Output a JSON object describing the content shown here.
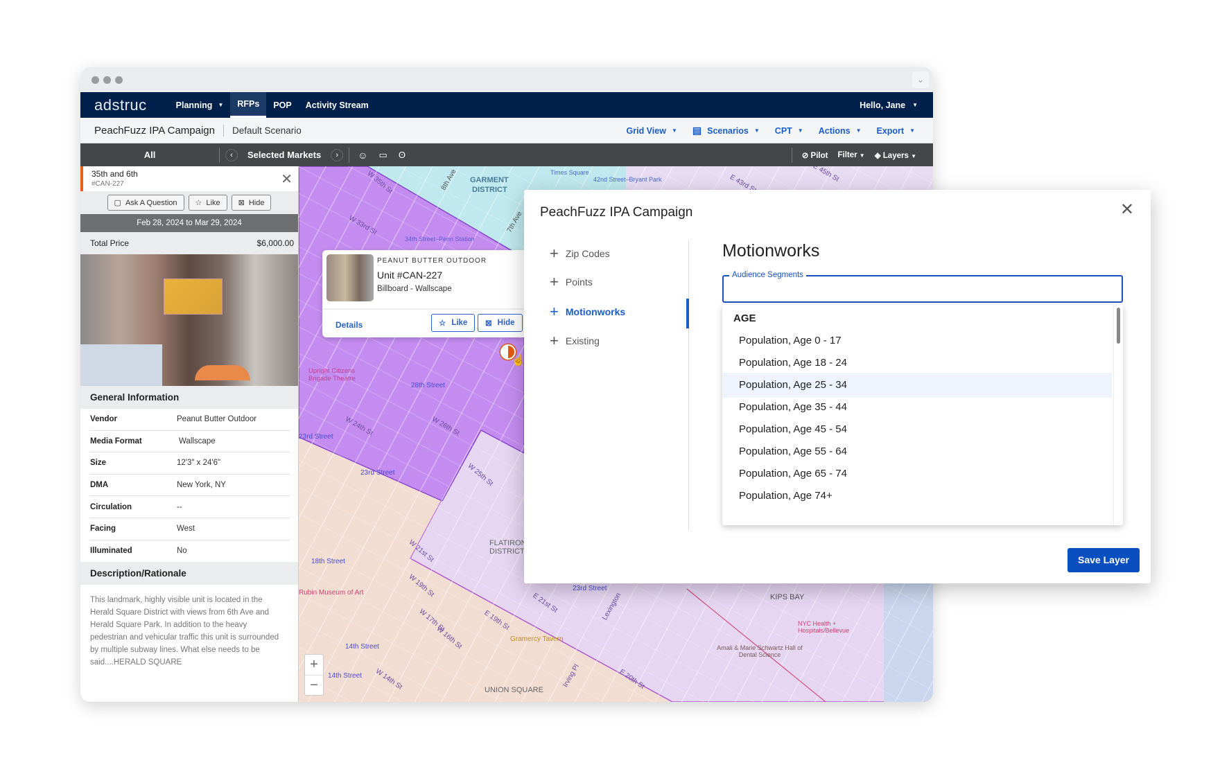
{
  "app": {
    "logo": "adstruc",
    "nav": [
      {
        "label": "Planning"
      },
      {
        "label": "RFPs"
      },
      {
        "label": "POP"
      },
      {
        "label": "Activity Stream"
      }
    ],
    "user": "Hello, Jane"
  },
  "subheader": {
    "campaign": "PeachFuzz IPA Campaign",
    "scenario": "Default Scenario",
    "menus": [
      "Grid View",
      "Scenarios",
      "CPT",
      "Actions",
      "Export"
    ]
  },
  "toolbar": {
    "all": "All",
    "markets": "Selected Markets",
    "pilot": "Pilot",
    "filter": "Filter",
    "layers": "Layers"
  },
  "unit_panel": {
    "title": "35th and 6th",
    "id": "#CAN-227",
    "buttons": [
      "Ask A Question",
      "Like",
      "Hide"
    ],
    "dates": "Feb 28, 2024 to Mar 29, 2024",
    "total_price_label": "Total Price",
    "total_price": "$6,000.00",
    "general_header": "General Information",
    "info": [
      {
        "k": "Vendor",
        "v": "Peanut Butter Outdoor"
      },
      {
        "k": "Media Format",
        "v": "Wallscape"
      },
      {
        "k": "Size",
        "v": "12'3\" x 24'6\""
      },
      {
        "k": "DMA",
        "v": "New York, NY"
      },
      {
        "k": "Circulation",
        "v": "--"
      },
      {
        "k": "Facing",
        "v": "West"
      },
      {
        "k": "Illuminated",
        "v": "No"
      }
    ],
    "desc_header": "Description/Rationale",
    "description": "This landmark, highly visible unit is located in the Herald Square District with views from 6th Ave and Herald Square Park. In addition to the heavy pedestrian and vehicular traffic this unit is surrounded by multiple subway lines. What else needs to be said....HERALD SQUARE"
  },
  "popup": {
    "vendor": "PEANUT BUTTER OUTDOOR",
    "unit": "Unit #CAN-227",
    "format": "Billboard - Wallscape",
    "details": "Details",
    "like": "Like",
    "hide": "Hide"
  },
  "map": {
    "labels": [
      "W 35th St",
      "GARMENT",
      "DISTRICT",
      "8th Ave",
      "W 33rd St",
      "34th Street–Penn Station",
      "Upright Citizens Brigade Theatre",
      "28th Street",
      "W 26th St",
      "W 24th St",
      "23rd Street",
      "23rd Street",
      "W 25th St",
      "18th Street",
      "Rubin Museum of Art",
      "W 21st St",
      "W 19th St",
      "14th Street",
      "14th Street",
      "W 14th St",
      "FLATIRON DISTRICT",
      "UNION SQUARE",
      "Gramercy Tavern",
      "E 19th St",
      "E 21st St",
      "23rd Street",
      "KIPS BAY",
      "NYC Health + Hospitals/Bellevue",
      "Amali & Marie Schwartz Hall of Dental Science",
      "E 20th St",
      "Irving Pl",
      "Lexington",
      "E 45th St",
      "E 43rd St",
      "Times Square",
      "42nd Street–Bryant Park",
      "7th Ave",
      "W 17th St",
      "W 16th St"
    ],
    "zoom_in": "+",
    "zoom_out": "−"
  },
  "modal": {
    "title": "PeachFuzz IPA Campaign",
    "nav": [
      {
        "label": "Zip Codes"
      },
      {
        "label": "Points"
      },
      {
        "label": "Motionworks"
      },
      {
        "label": "Existing"
      }
    ],
    "heading": "Motionworks",
    "field_label": "Audience Segments",
    "field_value": "",
    "group": "AGE",
    "options": [
      "Population, Age 0 - 17",
      "Population, Age 18 - 24",
      "Population, Age 25 - 34",
      "Population, Age 35 - 44",
      "Population, Age 45 - 54",
      "Population, Age 55 - 64",
      "Population, Age 65 - 74",
      "Population, Age 74+"
    ],
    "highlighted": "Population, Age 25 - 34",
    "save": "Save Layer"
  },
  "colors": {
    "navy": "#00204c",
    "accent": "#1a5dc8",
    "marker": "#e25a0c",
    "zone_purple": "#c48cf0"
  }
}
